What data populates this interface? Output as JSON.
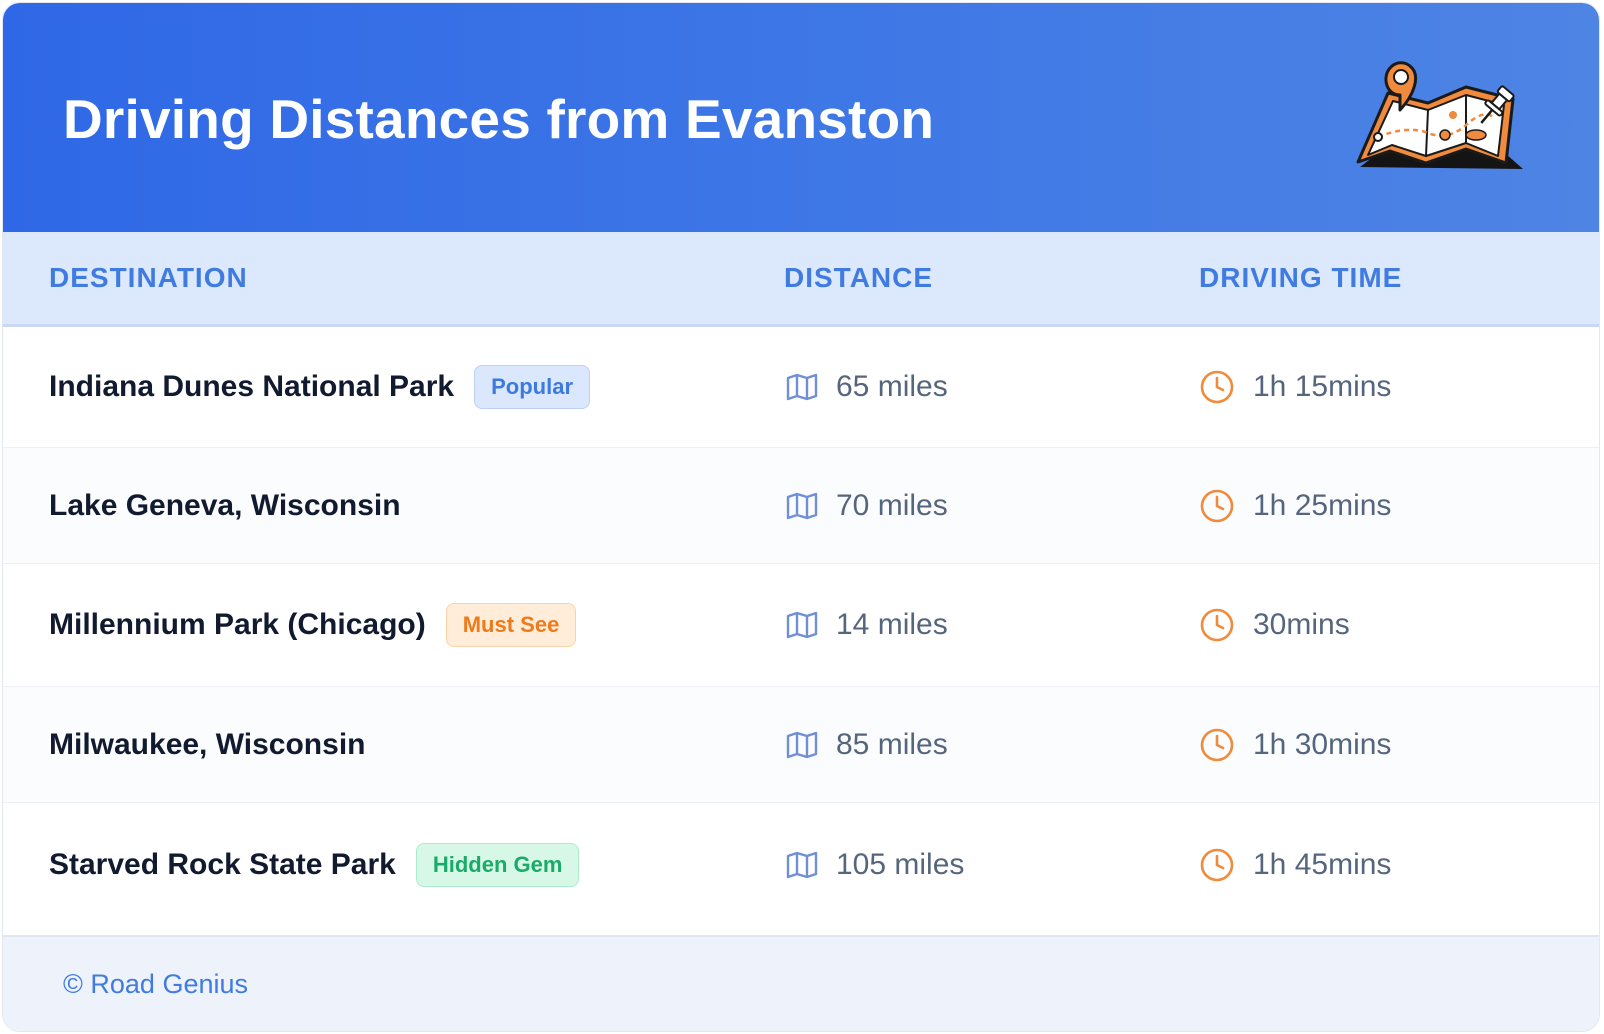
{
  "header": {
    "title": "Driving Distances from Evanston",
    "illustration_icon": "map-with-pins-icon"
  },
  "table": {
    "columns": [
      "DESTINATION",
      "DISTANCE",
      "DRIVING TIME"
    ],
    "rows": [
      {
        "destination": "Indiana Dunes National Park",
        "badge": "Popular",
        "badge_color": "#3d7ae0",
        "distance": "65 miles",
        "time": "1h 15mins"
      },
      {
        "destination": "Lake Geneva, Wisconsin",
        "badge": "",
        "badge_color": "",
        "distance": "70 miles",
        "time": "1h 25mins"
      },
      {
        "destination": "Millennium Park (Chicago)",
        "badge": "Must See",
        "badge_color": "#ef7a1a",
        "distance": "14 miles",
        "time": "30mins"
      },
      {
        "destination": "Milwaukee, Wisconsin",
        "badge": "",
        "badge_color": "",
        "distance": "85 miles",
        "time": "1h 30mins"
      },
      {
        "destination": "Starved Rock State Park",
        "badge": "Hidden Gem",
        "badge_color": "#1aab69",
        "distance": "105 miles",
        "time": "1h 45mins"
      }
    ],
    "distance_icon": "map-icon",
    "time_icon": "clock-icon"
  },
  "footer": {
    "text": "© Road Genius"
  },
  "colors": {
    "header_gradient_start": "#2f68e6",
    "header_gradient_end": "#4e84e4",
    "accent_blue": "#3f7be0",
    "accent_orange": "#f08a3c"
  }
}
